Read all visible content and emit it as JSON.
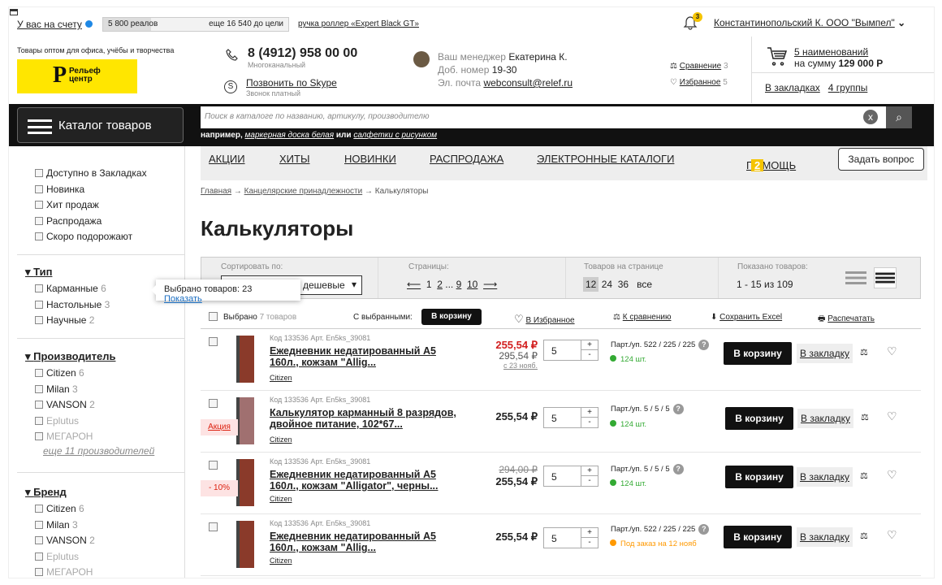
{
  "top": {
    "balance_label": "У вас на счету",
    "balance_value": "5 800 реалов",
    "balance_goal": "еще 16 540 до цели",
    "goal_progress": 0.26,
    "goal_link": "ручка роллер «Expert Black GT»",
    "notifications": "3",
    "user": "Константинопольский К.  ООО \"Вымпел\""
  },
  "header": {
    "tagline": "Товары оптом для офиса, учёбы и творчества",
    "logo_p": "Р",
    "logo_text_1": "Рельеф",
    "logo_text_2": "центр",
    "phone": "8 (4912) 958 00 00",
    "phone_sub": "Многоканальный",
    "skype_link": "Позвонить по Skype",
    "skype_sub": "Звонок платный",
    "manager_label": "Ваш менеджер",
    "manager_name": "Екатерина К.",
    "ext_label": "Доб. номер",
    "ext_value": "19-30",
    "email_label": "Эл. почта",
    "email": "webconsult@relef.ru",
    "compare_label": "Сравнение",
    "compare_count": "3",
    "fav_label": "Избранное",
    "fav_count": "5",
    "cart_items": "5 наименований",
    "cart_sum_label": "на сумму",
    "cart_sum": "129 000 Р",
    "bookmarks_label": "В закладках",
    "bookmarks_groups": "4 группы"
  },
  "search": {
    "catalog_button": "Каталог товаров",
    "placeholder": "Поиск в каталоге по названию, артикулу, производителю",
    "clear": "x",
    "example_prefix": "например,",
    "example_1": "маркерная доска белая",
    "example_or": "или",
    "example_2": "салфетки с рисунком"
  },
  "nav": {
    "items": [
      "АКЦИИ",
      "ХИТЫ",
      "НОВИНКИ",
      "РАСПРОДАЖА",
      "ЭЛЕКТРОННЫЕ КАТАЛОГИ"
    ],
    "help": "ПОМОЩЬ",
    "help_count": "2",
    "ask": "Задать вопрос"
  },
  "breadcrumb": [
    "Главная",
    "Канцелярские принадлежности",
    "Калькуляторы"
  ],
  "page_title": "Калькуляторы",
  "filters": {
    "general": [
      "Доступно в Закладках",
      "Новинка",
      "Хит продаж",
      "Распродажа",
      "Скоро подорожают"
    ],
    "type_title": "Тип",
    "type": [
      {
        "name": "Карманные",
        "count": "6"
      },
      {
        "name": "Настольные",
        "count": "3"
      },
      {
        "name": "Научные",
        "count": "2"
      }
    ],
    "maker_title": "Производитель",
    "maker": [
      {
        "name": "Citizen",
        "count": "6"
      },
      {
        "name": "Milan",
        "count": "3"
      },
      {
        "name": "VANSON",
        "count": "2"
      },
      {
        "name": "Eplutus",
        "count": ""
      },
      {
        "name": "МЕГАРОН",
        "count": ""
      }
    ],
    "maker_more": "еще 11 производителей",
    "brand_title": "Бренд",
    "brand": [
      {
        "name": "Citizen",
        "count": "6"
      },
      {
        "name": "Milan",
        "count": "3"
      },
      {
        "name": "VANSON",
        "count": "2"
      },
      {
        "name": "Eplutus",
        "count": ""
      },
      {
        "name": "МЕГАРОН",
        "count": ""
      }
    ]
  },
  "tooltip": {
    "text": "Выбрано товаров: 23",
    "link": "Показать"
  },
  "toolbar": {
    "sort_label": "Сортировать по:",
    "sort_value": "дешевые",
    "pages_label": "Страницы:",
    "pages": [
      "1",
      "2",
      "...",
      "9",
      "10"
    ],
    "per_page_label": "Товаров на странице",
    "per_page": [
      "12",
      "24",
      "36",
      "все"
    ],
    "shown_label": "Показано товаров:",
    "shown": "1 - 15 из 109"
  },
  "selection": {
    "selected": "Выбрано",
    "selected_count": "7 товаров",
    "with_selected": "С выбранными:",
    "to_cart": "В корзину",
    "to_fav": "В Избранное",
    "to_compare": "К сравнению",
    "excel": "Сохранить Excel",
    "print": "Распечатать"
  },
  "products": [
    {
      "code": "Код 133536   Арт. En5ks_39081",
      "name": "Ежедневник недатированный А5 160л., кожзам \"Allig...",
      "brand": "Citizen",
      "price": "255,54 ₽",
      "old_price": "295,54 ₽",
      "price_note": "с 23 нояб.",
      "qty": "5",
      "part": "Парт./уп.  522 / 225 / 225",
      "stock": "124 шт.",
      "buy": "В корзину",
      "bookmark": "В закладку",
      "promo": ""
    },
    {
      "code": "Код 133536   Арт. En5ks_39081",
      "name": "Калькулятор карманный 8 разрядов, двойное питание, 102*67...",
      "brand": "Citizen",
      "price": "255,54 ₽",
      "old_price": "",
      "price_note": "",
      "qty": "5",
      "part": "Парт./уп.  5 / 5 / 5",
      "stock": "124 шт.",
      "buy": "В корзину",
      "bookmark": "В закладку",
      "promo": "Акция"
    },
    {
      "code": "Код 133536   Арт. En5ks_39081",
      "name": "Ежедневник недатированный А5 160л., кожзам \"Alligator\", черны...",
      "brand": "Citizen",
      "price": "255,54 ₽",
      "old_price": "294,00 ₽",
      "price_note": "",
      "qty": "5",
      "part": "Парт./уп.  5 / 5 / 5",
      "stock": "124 шт.",
      "buy": "В корзину",
      "bookmark": "В закладку",
      "promo": "- 10%"
    },
    {
      "code": "Код 133536   Арт. En5ks_39081",
      "name": "Ежедневник недатированный А5 160л., кожзам \"Allig...",
      "brand": "Citizen",
      "price": "255,54 ₽",
      "old_price": "",
      "price_note": "",
      "qty": "5",
      "part": "Парт./уп.  522 / 225 / 225",
      "stock": "Под заказ на 12 нояб",
      "buy": "В корзину",
      "bookmark": "В закладку",
      "promo": ""
    }
  ],
  "colors": {
    "accent": "#ffe600",
    "dark": "#111111",
    "price_red": "#d21f1f",
    "in_stock": "#33aa33",
    "on_order": "#ff9900",
    "link": "#1a6ec2"
  }
}
